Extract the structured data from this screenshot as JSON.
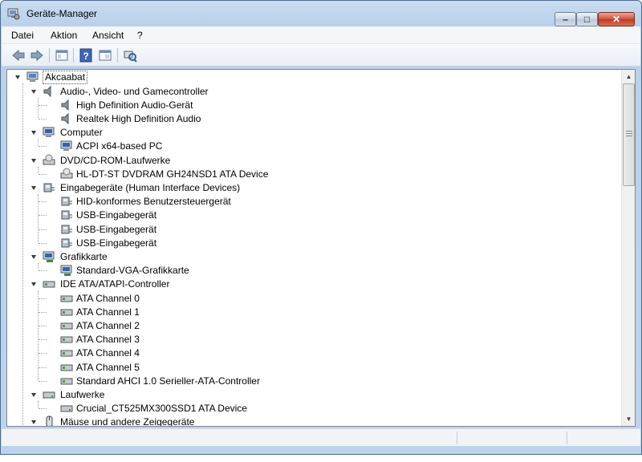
{
  "window": {
    "title": "Geräte-Manager",
    "title_icon": "device-manager-icon"
  },
  "controls": {
    "minimize": "–",
    "maximize": "□",
    "close": "✕"
  },
  "menu": [
    "Datei",
    "Aktion",
    "Ansicht",
    "?"
  ],
  "toolbar": [
    "back-arrow-icon",
    "forward-arrow-icon",
    "properties-view-icon",
    "help-icon",
    "console-tree-icon",
    "scan-hardware-icon"
  ],
  "tree": {
    "root": "Akcaabat",
    "categories": [
      {
        "label": "Audio-, Video- und Gamecontroller",
        "icon": "speaker-icon",
        "children": [
          "High Definition Audio-Gerät",
          "Realtek High Definition Audio"
        ]
      },
      {
        "label": "Computer",
        "icon": "computer-icon",
        "children": [
          "ACPI x64-based PC"
        ]
      },
      {
        "label": "DVD/CD-ROM-Laufwerke",
        "icon": "optical-drive-icon",
        "children": [
          "HL-DT-ST DVDRAM GH24NSD1 ATA Device"
        ]
      },
      {
        "label": "Eingabegeräte (Human Interface Devices)",
        "icon": "hid-icon",
        "children": [
          "HID-konformes Benutzersteuergerät",
          "USB-Eingabegerät",
          "USB-Eingabegerät",
          "USB-Eingabegerät"
        ]
      },
      {
        "label": "Grafikkarte",
        "icon": "display-adapter-icon",
        "children": [
          "Standard-VGA-Grafikkarte"
        ]
      },
      {
        "label": "IDE ATA/ATAPI-Controller",
        "icon": "ide-controller-icon",
        "children": [
          "ATA Channel 0",
          "ATA Channel 1",
          "ATA Channel 2",
          "ATA Channel 3",
          "ATA Channel 4",
          "ATA Channel 5",
          "Standard AHCI 1.0 Serieller-ATA-Controller"
        ]
      },
      {
        "label": "Laufwerke",
        "icon": "disk-drive-icon",
        "children": [
          "Crucial_CT525MX300SSD1 ATA Device"
        ]
      },
      {
        "label": "Mäuse und andere Zeigegeräte",
        "icon": "mouse-icon",
        "children": []
      }
    ]
  },
  "colors": {
    "selection_border": "#555555",
    "title_bar": "#b9d1ea",
    "close_button": "#c94a33"
  }
}
